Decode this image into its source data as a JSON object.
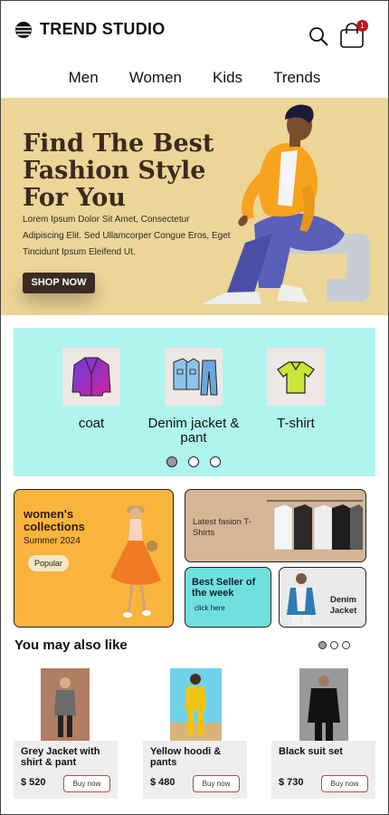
{
  "header": {
    "brand": "TREND STUDIO",
    "cart_count": "1",
    "nav": [
      "Men",
      "Women",
      "Kids",
      "Trends"
    ]
  },
  "hero": {
    "title": "Find The Best Fashion Style For You",
    "description": "Lorem Ipsum Dolor Sit Amet, Consectetur Adipiscing Elit. Sed Ullamcorper Congue Eros, Eget Tincidunt Ipsum Eleifend Ut.",
    "cta": "SHOP NOW",
    "bg_color": "#ecd596"
  },
  "categories": {
    "items": [
      {
        "label": "coat",
        "icon": "coat-icon"
      },
      {
        "label": "Denim jacket & pant",
        "icon": "denim-icon"
      },
      {
        "label": "T-shirt",
        "icon": "tshirt-icon"
      }
    ],
    "active_dot": 0,
    "bg_color": "#aff4ef"
  },
  "promos": {
    "women": {
      "title": "women's collections",
      "subtitle": "Summer 2024",
      "tag": "Popular"
    },
    "tees": {
      "title": "Latest fasion T-Shirts"
    },
    "best_seller": {
      "title": "Best Seller of the week",
      "link": "click here"
    },
    "denim": {
      "title": "Denim Jacket"
    }
  },
  "recommend": {
    "title": "You may also like",
    "products": [
      {
        "name": "Grey Jacket with shirt & pant",
        "price": "$ 520",
        "button": "Buy now"
      },
      {
        "name": "Yellow hoodi & pants",
        "price": "$ 480",
        "button": "Buy now"
      },
      {
        "name": "Black suit set",
        "price": "$ 730",
        "button": "Buy now"
      }
    ]
  }
}
